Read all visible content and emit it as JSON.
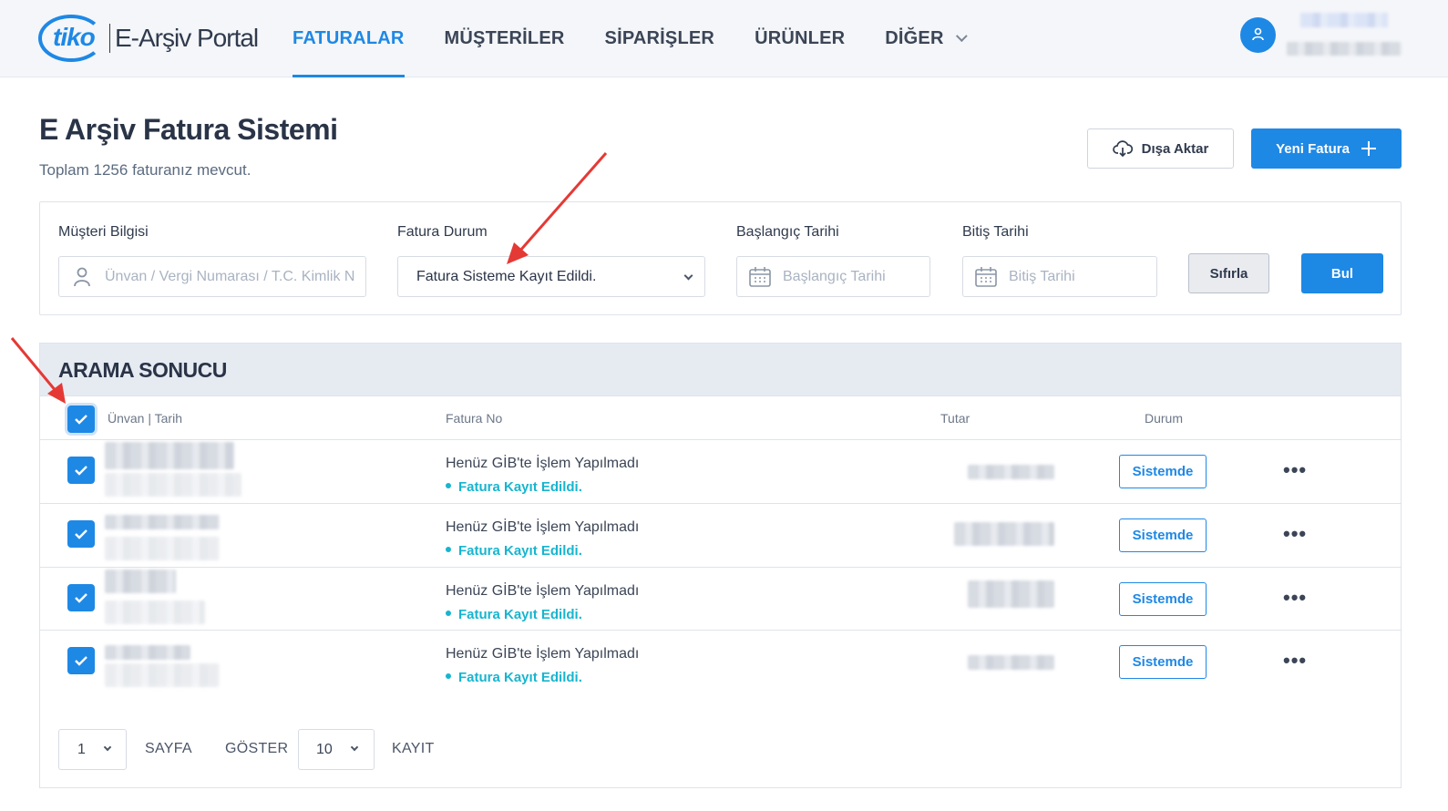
{
  "brand": {
    "logo_mark": "tiko",
    "product": "E-Arşiv Portal"
  },
  "nav": {
    "items": [
      {
        "label": "FATURALAR",
        "active": true
      },
      {
        "label": "MÜŞTERİLER",
        "active": false
      },
      {
        "label": "SİPARİŞLER",
        "active": false
      },
      {
        "label": "ÜRÜNLER",
        "active": false
      },
      {
        "label": "DİĞER",
        "active": false,
        "has_dropdown": true
      }
    ]
  },
  "user": {
    "avatar_icon": "user-icon",
    "name_obscured": true
  },
  "header": {
    "title": "E Arşiv Fatura Sistemi",
    "subtitle": "Toplam 1256 faturanız mevcut.",
    "export_label": "Dışa Aktar",
    "new_label": "Yeni Fatura"
  },
  "filters": {
    "customer": {
      "label": "Müşteri Bilgisi",
      "placeholder": "Ünvan / Vergi Numarası / T.C. Kimlik N"
    },
    "status": {
      "label": "Fatura Durum",
      "value": "Fatura Sisteme Kayıt Edildi."
    },
    "start": {
      "label": "Başlangıç Tarihi",
      "placeholder": "Başlangıç Tarihi"
    },
    "end": {
      "label": "Bitiş Tarihi",
      "placeholder": "Bitiş Tarihi"
    },
    "reset_label": "Sıfırla",
    "find_label": "Bul"
  },
  "results": {
    "title": "ARAMA SONUCU",
    "columns": {
      "name": "Ünvan | Tarih",
      "invoice_no": "Fatura No",
      "amount": "Tutar",
      "status": "Durum"
    },
    "rows": [
      {
        "checked": true,
        "gib_status": "Henüz GİB'te İşlem Yapılmadı",
        "record_status": "Fatura Kayıt Edildi.",
        "badge": "Sistemde"
      },
      {
        "checked": true,
        "gib_status": "Henüz GİB'te İşlem Yapılmadı",
        "record_status": "Fatura Kayıt Edildi.",
        "badge": "Sistemde"
      },
      {
        "checked": true,
        "gib_status": "Henüz GİB'te İşlem Yapılmadı",
        "record_status": "Fatura Kayıt Edildi.",
        "badge": "Sistemde"
      },
      {
        "checked": true,
        "gib_status": "Henüz GİB'te İşlem Yapılmadı",
        "record_status": "Fatura Kayıt Edildi.",
        "badge": "Sistemde"
      }
    ],
    "more_glyph": "•••"
  },
  "pagination": {
    "page": "1",
    "page_label": "SAYFA",
    "show_label": "GÖSTER",
    "page_size": "10",
    "records_label": "KAYIT"
  },
  "colors": {
    "accent": "#1e88e5",
    "status_teal": "#17b5cf",
    "annotation_red": "#e53935",
    "panel_head": "#e6ebf2"
  }
}
